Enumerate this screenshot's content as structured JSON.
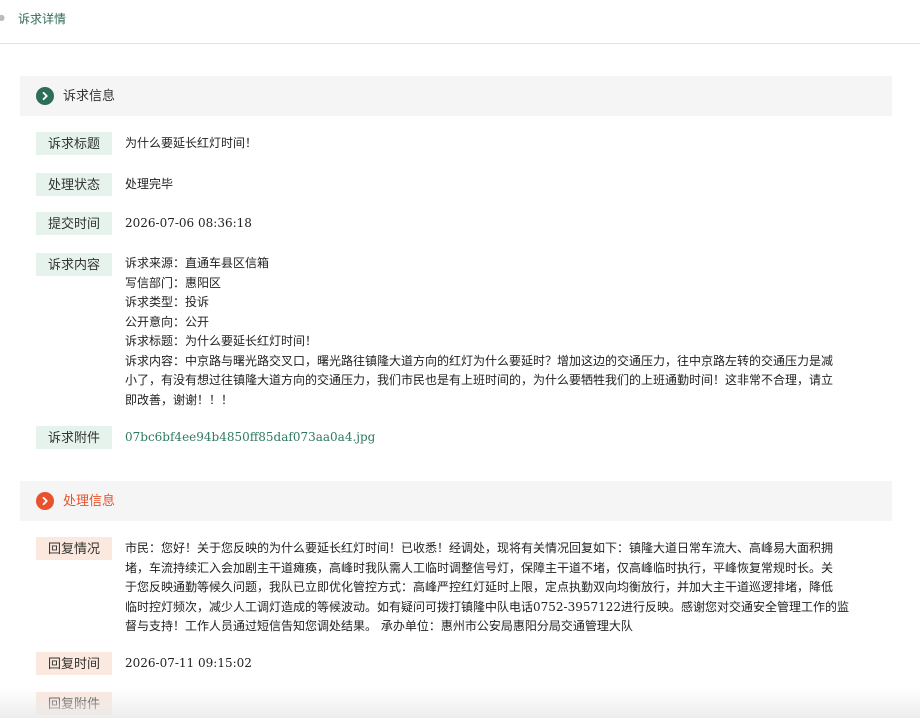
{
  "breadcrumb": {
    "current": "诉求详情"
  },
  "appeal_section": {
    "title": "诉求信息",
    "accent_color": "#2e6e58",
    "icon": "chevron-right-icon",
    "fields": {
      "title_label": "诉求标题",
      "title_value": "为什么要延长红灯时间！",
      "status_label": "处理状态",
      "status_value": "处理完毕",
      "submit_time_label": "提交时间",
      "submit_time_value": "2026-07-06 08:36:18",
      "content_label": "诉求内容",
      "content_lines": [
        "诉求来源：直通车县区信箱",
        "写信部门：惠阳区",
        "诉求类型：投诉",
        "公开意向：公开",
        "诉求标题：为什么要延长红灯时间！",
        "诉求内容：中京路与曙光路交叉口，曙光路往镇隆大道方向的红灯为什么要延时？增加这边的交通压力，往中京路左转的交通压力是减",
        "小了，有没有想过往镇隆大道方向的交通压力，我们市民也是有上班时间的，为什么要牺牲我们的上班通勤时间！这非常不合理，请立",
        "即改善，谢谢！！！"
      ],
      "attachment_label": "诉求附件",
      "attachment_file": "07bc6bf4ee94b4850ff85daf073aa0a4.jpg"
    }
  },
  "handling_section": {
    "title": "处理信息",
    "accent_color": "#e8522c",
    "icon": "chevron-right-icon",
    "fields": {
      "reply_label": "回复情况",
      "reply_lines": [
        "市民：您好！关于您反映的为什么要延长红灯时间！已收悉！经调处，现将有关情况回复如下：镇隆大道日常车流大、高峰易大面积拥",
        "堵，车流持续汇入会加剧主干道瘫痪，高峰时我队需人工临时调整信号灯，保障主干道不堵，仅高峰临时执行，平峰恢复常规时长。关",
        "于您反映通勤等候久问题，我队已立即优化管控方式：高峰严控红灯延时上限，定点执勤双向均衡放行，并加大主干道巡逻排堵，降低",
        "临时控灯频次，减少人工调灯造成的等候波动。如有疑问可拨打镇隆中队电话0752-3957122进行反映。感谢您对交通安全管理工作的监",
        "督与支持！工作人员通过短信告知您调处结果。  承办单位：惠州市公安局惠阳分局交通管理大队"
      ],
      "reply_time_label": "回复时间",
      "reply_time_value": "2026-07-11 09:15:02",
      "reply_attachment_label": "回复附件"
    }
  }
}
